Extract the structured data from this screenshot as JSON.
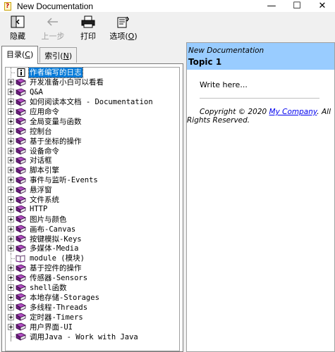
{
  "window": {
    "title": "New Documentation",
    "minimize_glyph": "—",
    "maximize_glyph": "☐",
    "close_glyph": "✕"
  },
  "toolbar": {
    "hide_label": "隐藏",
    "back_label": "上一步",
    "print_label": "打印",
    "options_label_text": "选项(",
    "options_label_key": "O",
    "options_label_end": ")"
  },
  "tabs": {
    "contents_text": "目录(",
    "contents_key": "C",
    "contents_end": ")",
    "index_text": "索引(",
    "index_key": "N",
    "index_end": ")"
  },
  "tree": {
    "items": [
      {
        "label": "作者编写的日志",
        "type": "page",
        "expandable": false,
        "selected": true
      },
      {
        "label": "开发准备小白可以看看",
        "type": "book",
        "expandable": true
      },
      {
        "label": "Q&A",
        "type": "book",
        "expandable": true
      },
      {
        "label": "如何阅读本文档 - Documentation",
        "type": "book",
        "expandable": true
      },
      {
        "label": "应用命令",
        "type": "book",
        "expandable": true
      },
      {
        "label": "全局变量与函数",
        "type": "book",
        "expandable": true
      },
      {
        "label": "控制台",
        "type": "book",
        "expandable": true
      },
      {
        "label": "基于坐标的操作",
        "type": "book",
        "expandable": true
      },
      {
        "label": "设备命令",
        "type": "book",
        "expandable": true
      },
      {
        "label": "对话框",
        "type": "book",
        "expandable": true
      },
      {
        "label": "脚本引擎",
        "type": "book",
        "expandable": true
      },
      {
        "label": "事件与监听-Events",
        "type": "book",
        "expandable": true
      },
      {
        "label": "悬浮窗",
        "type": "book",
        "expandable": true
      },
      {
        "label": "文件系统",
        "type": "book",
        "expandable": true
      },
      {
        "label": "HTTP",
        "type": "book",
        "expandable": true
      },
      {
        "label": "图片与颜色",
        "type": "book",
        "expandable": true
      },
      {
        "label": "画布-Canvas",
        "type": "book",
        "expandable": true
      },
      {
        "label": "按键模拟-Keys",
        "type": "book",
        "expandable": true
      },
      {
        "label": "多媒体-Media",
        "type": "book",
        "expandable": true
      },
      {
        "label": "module (模块)",
        "type": "openbook",
        "expandable": false
      },
      {
        "label": "基于控件的操作",
        "type": "book",
        "expandable": true
      },
      {
        "label": "传感器-Sensors",
        "type": "book",
        "expandable": true
      },
      {
        "label": "shell函数",
        "type": "book",
        "expandable": true
      },
      {
        "label": "本地存储-Storages",
        "type": "book",
        "expandable": true
      },
      {
        "label": "多线程-Threads",
        "type": "book",
        "expandable": true
      },
      {
        "label": "定时器-Timers",
        "type": "book",
        "expandable": true
      },
      {
        "label": "用户界面-UI",
        "type": "book",
        "expandable": true
      },
      {
        "label": "调用Java - Work with Java",
        "type": "book",
        "expandable": false
      }
    ]
  },
  "topic": {
    "doc_name": "New Documentation",
    "title": "Topic 1",
    "body": "Write here...",
    "copyright_prefix": "Copyright © 2020 ",
    "company_link": "My Company",
    "copyright_suffix": ". All Rights Reserved."
  },
  "colors": {
    "header_bg": "#99ccff",
    "selection": "#0078d7",
    "book_purple": "#7b2d8e",
    "link": "#0000ee"
  }
}
